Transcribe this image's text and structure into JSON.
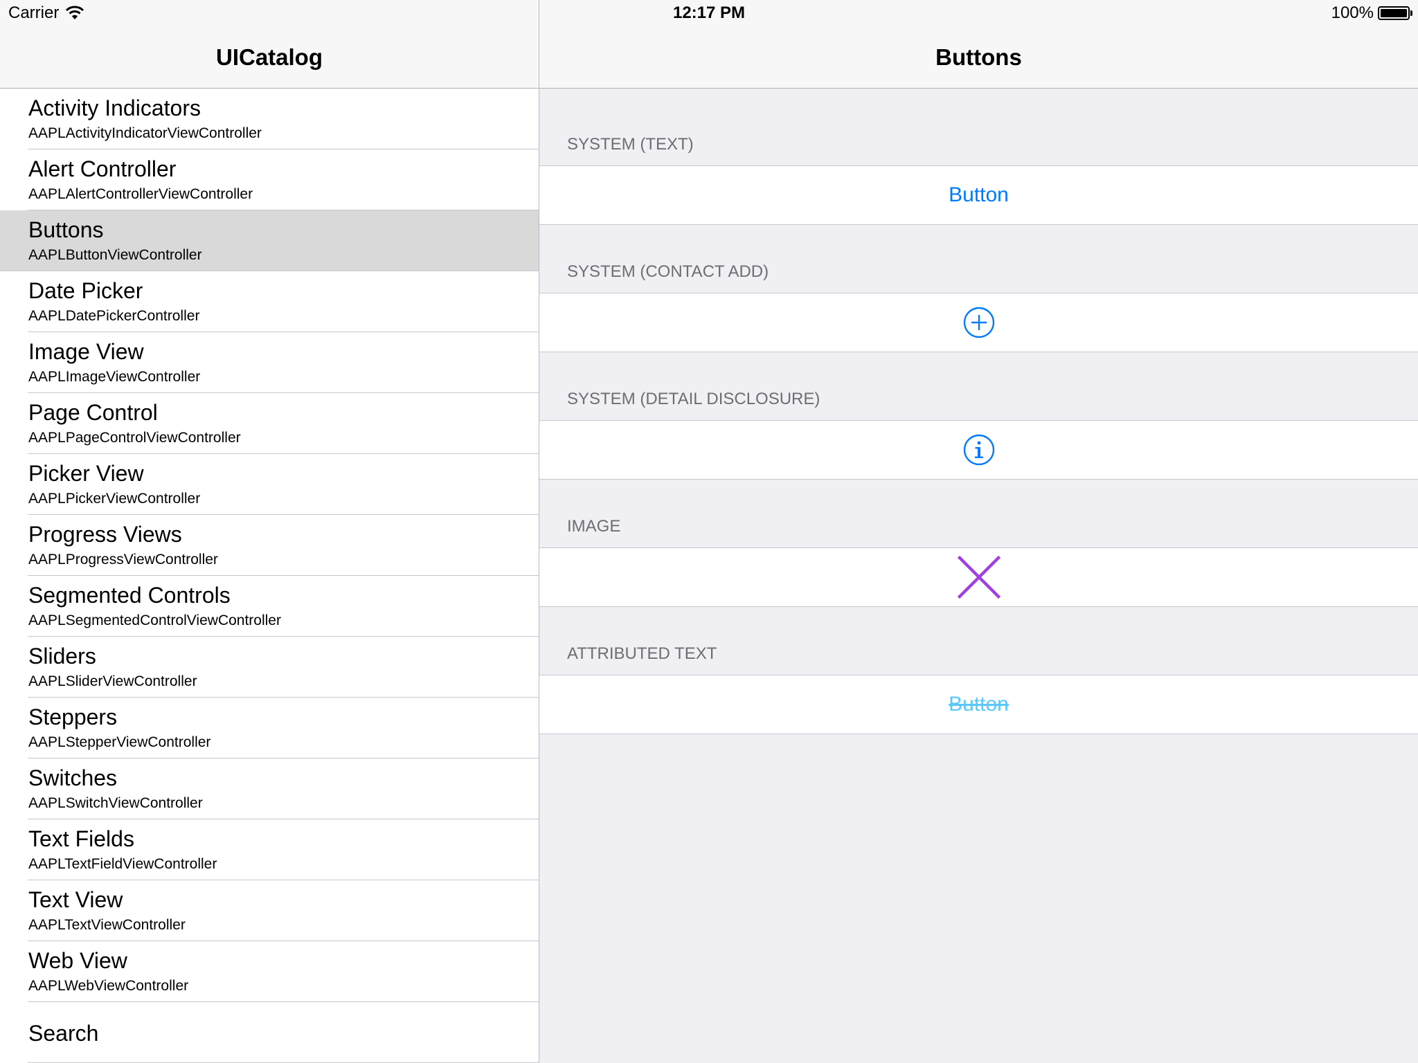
{
  "status_bar": {
    "carrier": "Carrier",
    "time": "12:17 PM",
    "battery_text": "100%",
    "battery_level": 1.0
  },
  "master": {
    "title": "UICatalog",
    "items": [
      {
        "title": "Activity Indicators",
        "subtitle": "AAPLActivityIndicatorViewController"
      },
      {
        "title": "Alert Controller",
        "subtitle": "AAPLAlertControllerViewController"
      },
      {
        "title": "Buttons",
        "subtitle": "AAPLButtonViewController"
      },
      {
        "title": "Date Picker",
        "subtitle": "AAPLDatePickerController"
      },
      {
        "title": "Image View",
        "subtitle": "AAPLImageViewController"
      },
      {
        "title": "Page Control",
        "subtitle": "AAPLPageControlViewController"
      },
      {
        "title": "Picker View",
        "subtitle": "AAPLPickerViewController"
      },
      {
        "title": "Progress Views",
        "subtitle": "AAPLProgressViewController"
      },
      {
        "title": "Segmented Controls",
        "subtitle": "AAPLSegmentedControlViewController"
      },
      {
        "title": "Sliders",
        "subtitle": "AAPLSliderViewController"
      },
      {
        "title": "Steppers",
        "subtitle": "AAPLStepperViewController"
      },
      {
        "title": "Switches",
        "subtitle": "AAPLSwitchViewController"
      },
      {
        "title": "Text Fields",
        "subtitle": "AAPLTextFieldViewController"
      },
      {
        "title": "Text View",
        "subtitle": "AAPLTextViewController"
      },
      {
        "title": "Web View",
        "subtitle": "AAPLWebViewController"
      },
      {
        "title": "Search",
        "subtitle": ""
      }
    ],
    "selected": "Buttons"
  },
  "detail": {
    "title": "Buttons",
    "sections": {
      "system_text": {
        "header": "SYSTEM (TEXT)",
        "button_label": "Button"
      },
      "contact_add": {
        "header": "SYSTEM (CONTACT ADD)",
        "icon": "plus-circle-icon"
      },
      "detail_disclosure": {
        "header": "SYSTEM (DETAIL DISCLOSURE)",
        "icon": "info-circle-icon"
      },
      "image": {
        "header": "IMAGE",
        "icon": "x-icon"
      },
      "attributed_text": {
        "header": "ATTRIBUTED TEXT",
        "button_label": "Button"
      }
    }
  },
  "colors": {
    "tint": "#007aff",
    "attributed": "#5ac8fa",
    "image_x": "#a040e0",
    "group_background": "#efeff4",
    "selected_row": "#d9d9d9"
  }
}
